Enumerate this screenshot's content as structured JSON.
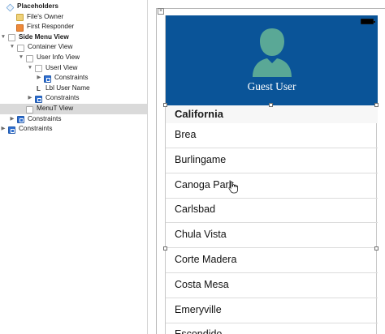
{
  "outline": {
    "items": [
      {
        "label": "Placeholders",
        "bold": true,
        "icon": "cube-icon",
        "icon_class": "cube",
        "indent": 8,
        "has_arrow": false
      },
      {
        "label": "File's Owner",
        "bold": false,
        "icon": "file-owner-icon",
        "icon_class": "owner",
        "indent": 20,
        "has_arrow": false
      },
      {
        "label": "First Responder",
        "bold": false,
        "icon": "first-responder-icon",
        "icon_class": "responder",
        "indent": 20,
        "has_arrow": false
      },
      {
        "label": "Side Menu View",
        "bold": true,
        "icon": "view-icon",
        "icon_class": "view",
        "indent": 10,
        "has_arrow": true,
        "expanded": true
      },
      {
        "label": "Container View",
        "bold": false,
        "icon": "view-icon",
        "icon_class": "view",
        "indent": 21,
        "has_arrow": true,
        "expanded": true
      },
      {
        "label": "User Info View",
        "bold": false,
        "icon": "view-icon",
        "icon_class": "view",
        "indent": 32,
        "has_arrow": true,
        "expanded": true
      },
      {
        "label": "UserI View",
        "bold": false,
        "icon": "view-icon",
        "icon_class": "view",
        "indent": 43,
        "has_arrow": true,
        "expanded": true
      },
      {
        "label": "Constraints",
        "bold": false,
        "icon": "constraints-icon",
        "icon_class": "cons",
        "indent": 54,
        "has_arrow": true,
        "expanded": false
      },
      {
        "label": "Lbl User Name",
        "bold": false,
        "icon": "label-icon",
        "icon_class": "lbl-ico",
        "icon_text": "L",
        "indent": 43,
        "has_arrow": false
      },
      {
        "label": "Constraints",
        "bold": false,
        "icon": "constraints-icon",
        "icon_class": "cons",
        "indent": 43,
        "has_arrow": true,
        "expanded": false
      },
      {
        "label": "MenuT View",
        "bold": false,
        "icon": "view-icon",
        "icon_class": "view",
        "indent": 32,
        "has_arrow": false,
        "selected": true
      },
      {
        "label": "Constraints",
        "bold": false,
        "icon": "constraints-icon",
        "icon_class": "cons",
        "indent": 21,
        "has_arrow": true,
        "expanded": false
      },
      {
        "label": "Constraints",
        "bold": false,
        "icon": "constraints-icon",
        "icon_class": "cons",
        "indent": 10,
        "has_arrow": true,
        "expanded": false
      }
    ]
  },
  "phone": {
    "header_color": "#0a5498",
    "avatar_color": "#5aa896",
    "user_name": "Guest User"
  },
  "table": {
    "section_title": "California",
    "rows": [
      "Brea",
      "Burlingame",
      "Canoga Park",
      "Carlsbad",
      "Chula Vista",
      "Corte Madera",
      "Costa Mesa",
      "Emeryville",
      "Escondido"
    ]
  }
}
